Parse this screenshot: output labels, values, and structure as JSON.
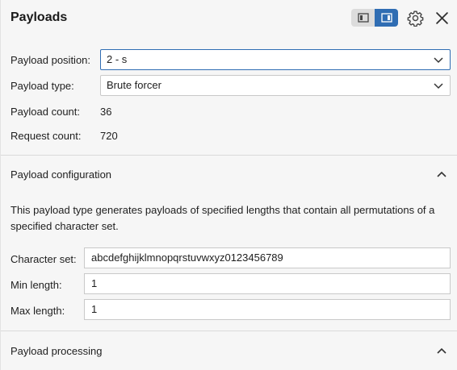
{
  "header": {
    "title": "Payloads"
  },
  "summary": {
    "position_label": "Payload position:",
    "position_value": "2 - s",
    "type_label": "Payload type:",
    "type_value": "Brute forcer",
    "count_label": "Payload count:",
    "count_value": "36",
    "request_label": "Request count:",
    "request_value": "720"
  },
  "config": {
    "title": "Payload configuration",
    "description": "This payload type generates payloads of specified lengths that contain all permutations of a specified character set.",
    "charset_label": "Character set:",
    "charset_value": "abcdefghijklmnopqrstuvwxyz0123456789",
    "min_label": "Min length:",
    "min_value": "1",
    "max_label": "Max length:",
    "max_value": "1"
  },
  "processing": {
    "title": "Payload processing"
  },
  "icons": {
    "layout_split": "layout-split-icon",
    "layout_side": "layout-side-icon",
    "settings": "gear-icon",
    "close": "close-icon",
    "chevron_down": "chevron-down-icon",
    "chevron_up": "chevron-up-icon"
  },
  "colors": {
    "accent": "#2f6db3",
    "background": "#f6f6f6"
  }
}
